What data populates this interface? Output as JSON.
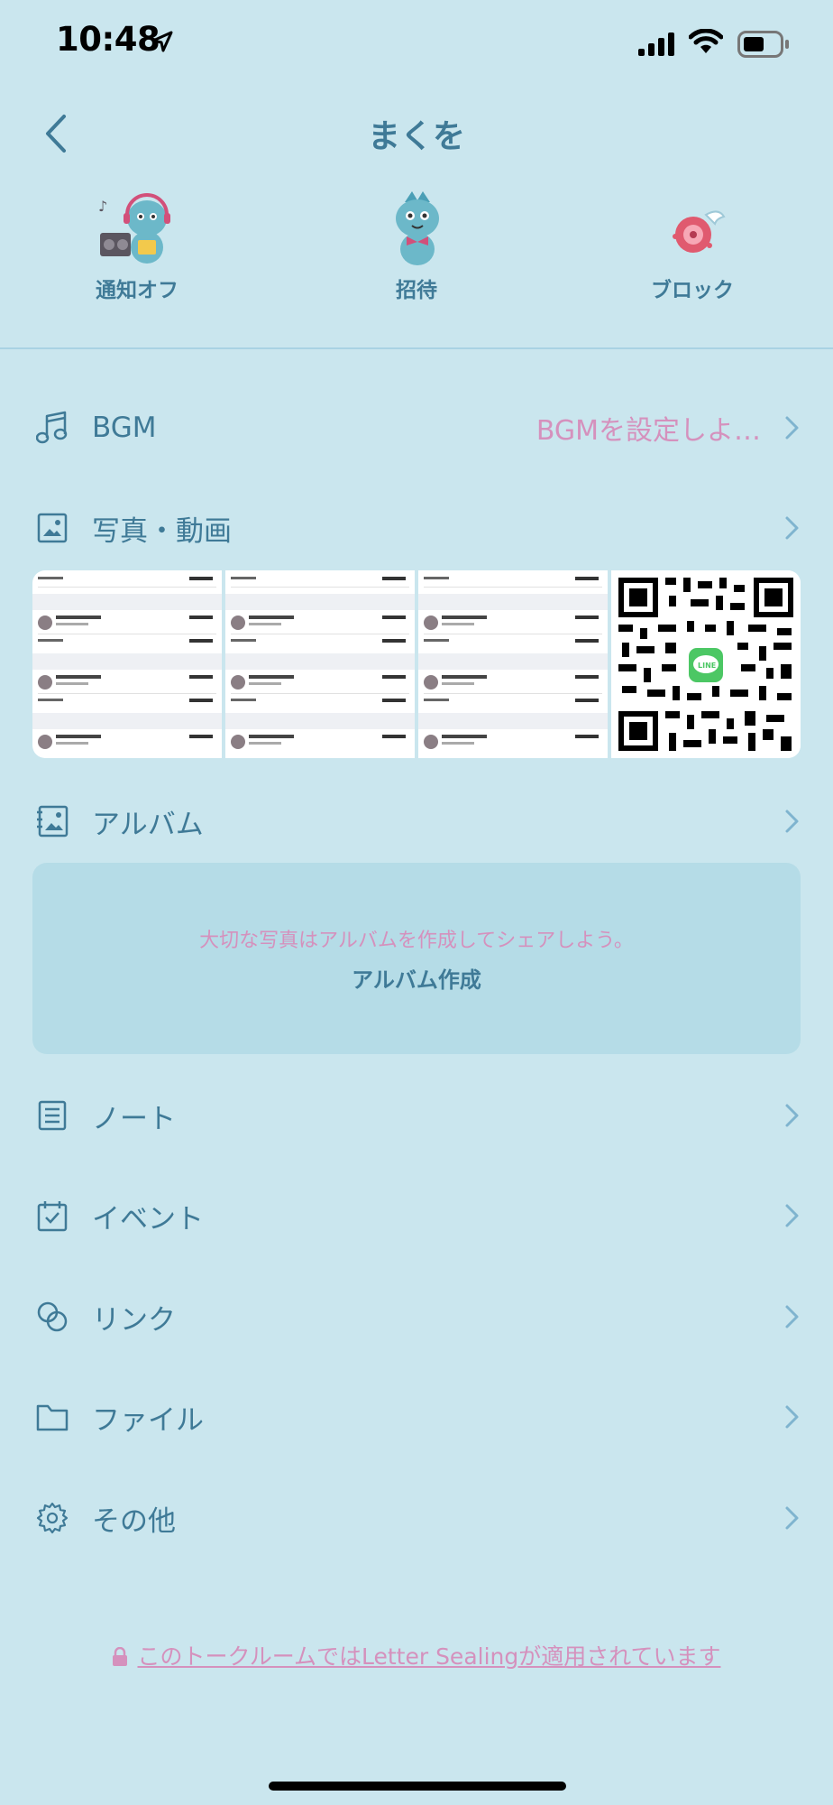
{
  "status": {
    "time": "10:48"
  },
  "header": {
    "title": "まくを"
  },
  "actions": [
    {
      "label": "通知オフ",
      "icon": "music-character-icon"
    },
    {
      "label": "招待",
      "icon": "character-invite-icon"
    },
    {
      "label": "ブロック",
      "icon": "character-block-icon"
    }
  ],
  "menu": {
    "bgm": {
      "label": "BGM",
      "value": "BGMを設定しよ…"
    },
    "photos": {
      "label": "写真・動画"
    },
    "album": {
      "label": "アルバム"
    },
    "note": {
      "label": "ノート"
    },
    "event": {
      "label": "イベント"
    },
    "link": {
      "label": "リンク"
    },
    "file": {
      "label": "ファイル"
    },
    "other": {
      "label": "その他"
    }
  },
  "album_box": {
    "message": "大切な写真はアルバムを作成してシェアしよう。",
    "create_label": "アルバム作成"
  },
  "footer": {
    "text": "このトークルームではLetter Sealingが適用されています"
  },
  "colors": {
    "background": "#cae6ee",
    "primary": "#3f7a97",
    "accent": "#d591bd",
    "chevron": "#7fb4cf"
  }
}
